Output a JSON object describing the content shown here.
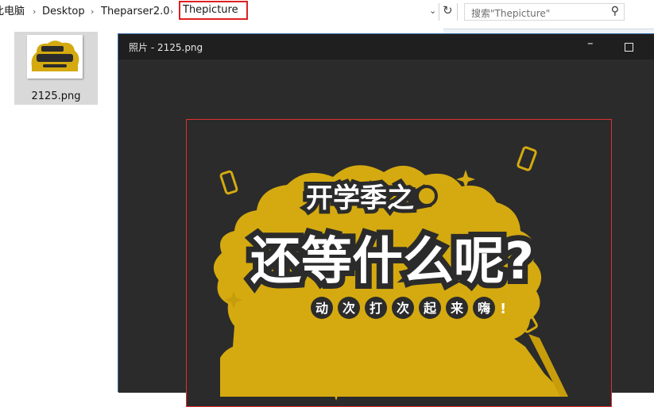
{
  "addressbar": {
    "crumbs": [
      "此电脑",
      "Desktop",
      "Theparser2.0"
    ],
    "current": "Thepicture",
    "search_placeholder": "搜索\"Thepicture\""
  },
  "file": {
    "name": "2125.png"
  },
  "viewer": {
    "title": "照片 - 2125.png"
  },
  "poster": {
    "headline_small": "开学季之",
    "headline_big": "还等什么呢?",
    "subline_chars": [
      "动",
      "次",
      "打",
      "次",
      "起",
      "来",
      "嗨"
    ],
    "subline_end": "!",
    "colors": {
      "background": "#2b2b2b",
      "cloud": "#d4aa10",
      "text": "#ffffff",
      "outline": "#2b2b2b"
    }
  }
}
